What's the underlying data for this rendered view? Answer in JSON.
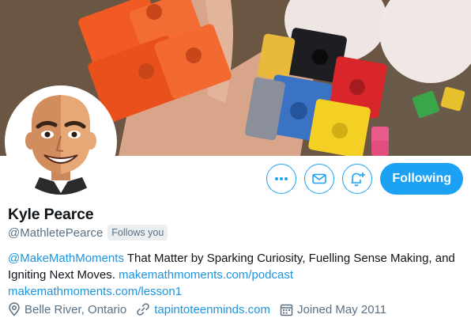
{
  "profile": {
    "name": "Kyle Pearce",
    "handle": "@MathletePearce",
    "follows_you": "Follows you",
    "bio": {
      "mention": "@MakeMathMoments",
      "text": " That Matter by Sparking Curiosity, Fuelling Sense Making, and Igniting Next Moves. ",
      "link1": "makemathmoments.com/podcast",
      "link2": "makemathmoments.com/lesson1"
    },
    "location": "Belle River, Ontario",
    "website": "tapintoteenminds.com",
    "joined": "Joined May 2011"
  },
  "actions": {
    "more_icon": "more-dots-icon",
    "message_icon": "envelope-icon",
    "notify_icon": "bell-plus-icon",
    "following_label": "Following"
  },
  "colors": {
    "accent": "#1da1f2",
    "link": "#1b95e0",
    "secondary_text": "#5b7083",
    "badge_bg": "#ebeef0"
  }
}
